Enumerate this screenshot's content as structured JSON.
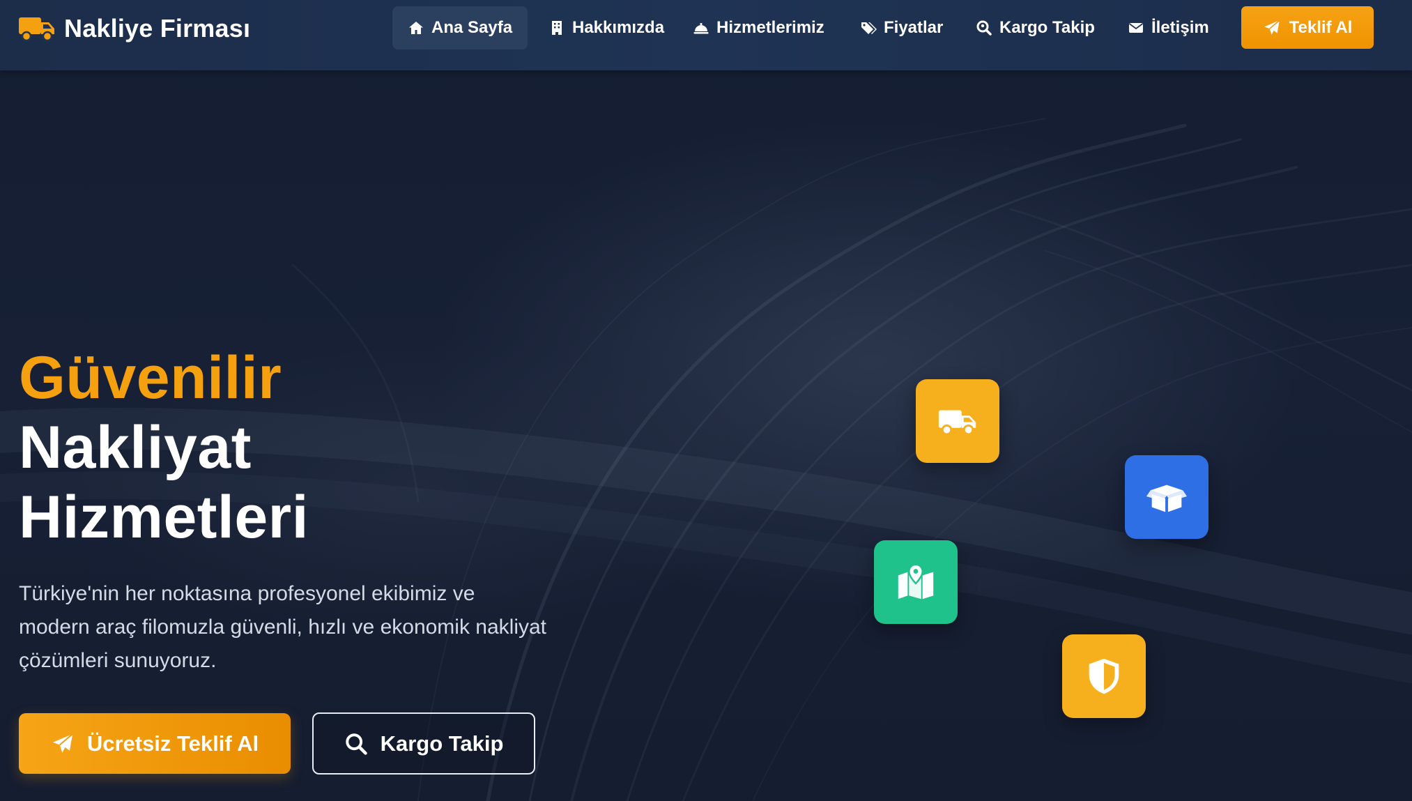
{
  "brand": {
    "name": "Nakliye Firması",
    "icon": "truck-icon",
    "accent": "#f5a00f"
  },
  "nav": {
    "items": [
      {
        "label": "Ana Sayfa",
        "icon": "home-icon",
        "active": true
      },
      {
        "label": "Hakkımızda",
        "icon": "building-icon",
        "active": false
      },
      {
        "label": "Hizmetlerimiz",
        "icon": "service-bell-icon",
        "active": false
      },
      {
        "label": "Fiyatlar",
        "icon": "tags-icon",
        "active": false
      },
      {
        "label": "Kargo Takip",
        "icon": "search-location-icon",
        "active": false
      },
      {
        "label": "İletişim",
        "icon": "envelope-icon",
        "active": false
      }
    ],
    "cta": {
      "label": "Teklif Al",
      "icon": "paper-plane-icon"
    }
  },
  "hero": {
    "title_lines": [
      "Güvenilir",
      "Nakliyat",
      "Hizmetleri"
    ],
    "description": "Türkiye'nin her noktasına profesyonel ekibimiz ve modern araç filomuzla güvenli, hızlı ve ekonomik nakliyat çözümleri sunuyoruz.",
    "primary_cta": {
      "label": "Ücretsiz Teklif Al",
      "icon": "paper-plane-icon"
    },
    "secondary_cta": {
      "label": "Kargo Takip",
      "icon": "search-icon"
    }
  },
  "tiles": [
    {
      "icon": "truck-icon",
      "color": "#f7b01d"
    },
    {
      "icon": "box-open-icon",
      "color": "#2f6fe6"
    },
    {
      "icon": "map-location-icon",
      "color": "#1fc28a"
    },
    {
      "icon": "shield-icon",
      "color": "#f7b01d"
    }
  ],
  "colors": {
    "navbar": "#1f3354",
    "background": "#151d30",
    "accent": "#f5a00f"
  }
}
